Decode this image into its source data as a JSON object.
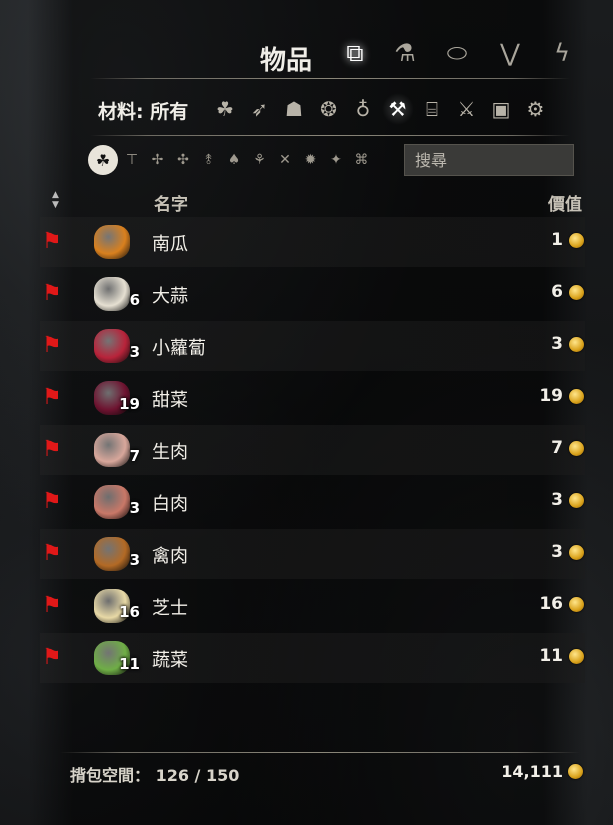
{
  "inventory": {
    "title": "物品",
    "categories": [
      {
        "name": "items",
        "icon": "cube-stack-icon",
        "glyph": "⧉",
        "active": true
      },
      {
        "name": "alchemy",
        "icon": "flask-icon",
        "glyph": "⚗",
        "active": false
      },
      {
        "name": "armor",
        "icon": "shield-icon",
        "glyph": "⬭",
        "active": false
      },
      {
        "name": "weapons",
        "icon": "blades-icon",
        "glyph": "⋁",
        "active": false
      },
      {
        "name": "misc",
        "icon": "lightning-icon",
        "glyph": "ϟ",
        "active": false
      }
    ],
    "filter": {
      "label": "材料: 所有",
      "icons": [
        {
          "icon": "triquetra-icon",
          "glyph": "☘",
          "active": false
        },
        {
          "icon": "bow-icon",
          "glyph": "➶",
          "active": false
        },
        {
          "icon": "hood-icon",
          "glyph": "☗",
          "active": false
        },
        {
          "icon": "rope-icon",
          "glyph": "❂",
          "active": false
        },
        {
          "icon": "potion-icon",
          "glyph": "♁",
          "active": false
        },
        {
          "icon": "crafting-hammer-icon",
          "glyph": "⚒",
          "active": true
        },
        {
          "icon": "scroll-icon",
          "glyph": "⌸",
          "active": false
        },
        {
          "icon": "sword-bone-icon",
          "glyph": "⚔",
          "active": false
        },
        {
          "icon": "blocks-icon",
          "glyph": "▣",
          "active": false
        },
        {
          "icon": "gears-icon",
          "glyph": "⚙",
          "active": false
        }
      ]
    },
    "subfilters": [
      {
        "icon": "all-materials-icon",
        "glyph": "☘",
        "active": true
      },
      {
        "icon": "anvil-icon",
        "glyph": "⊤",
        "active": false
      },
      {
        "icon": "herb-icon",
        "glyph": "✢",
        "active": false
      },
      {
        "icon": "plant-icon",
        "glyph": "✣",
        "active": false
      },
      {
        "icon": "torch-icon",
        "glyph": "⥉",
        "active": false
      },
      {
        "icon": "mushroom-icon",
        "glyph": "♠",
        "active": false
      },
      {
        "icon": "flower-icon",
        "glyph": "⚘",
        "active": false
      },
      {
        "icon": "crossed-tools-icon",
        "glyph": "✕",
        "active": false
      },
      {
        "icon": "gem-icon",
        "glyph": "✹",
        "active": false
      },
      {
        "icon": "sparkle-icon",
        "glyph": "✦",
        "active": false
      },
      {
        "icon": "junk-icon",
        "glyph": "⌘",
        "active": false
      }
    ],
    "search_placeholder": "搜尋",
    "columns": {
      "name": "名字",
      "value": "價值"
    },
    "sort_icon": "▲▼",
    "items": [
      {
        "name": "南瓜",
        "qty": "",
        "value": "1",
        "icon": "pumpkin-icon",
        "color": "#d9801e"
      },
      {
        "name": "大蒜",
        "qty": "6",
        "value": "6",
        "icon": "garlic-icon",
        "color": "#e6e0d2"
      },
      {
        "name": "小蘿蔔",
        "qty": "3",
        "value": "3",
        "icon": "radish-icon",
        "color": "#b8233a"
      },
      {
        "name": "甜菜",
        "qty": "19",
        "value": "19",
        "icon": "beet-icon",
        "color": "#6e1330"
      },
      {
        "name": "生肉",
        "qty": "7",
        "value": "7",
        "icon": "raw-meat-icon",
        "color": "#d8a79b"
      },
      {
        "name": "白肉",
        "qty": "3",
        "value": "3",
        "icon": "white-meat-icon",
        "color": "#c97868"
      },
      {
        "name": "禽肉",
        "qty": "3",
        "value": "3",
        "icon": "poultry-icon",
        "color": "#b36a25"
      },
      {
        "name": "芝士",
        "qty": "16",
        "value": "16",
        "icon": "cheese-icon",
        "color": "#e8d9a6"
      },
      {
        "name": "蔬菜",
        "qty": "11",
        "value": "11",
        "icon": "vegetables-icon",
        "color": "#6fae46"
      }
    ],
    "footer": {
      "capacity_label": "揹包空間： 126 / 150",
      "gold_total": "14,111"
    },
    "tag_icon": "red-tag-icon",
    "tag_glyph": "⚑",
    "tag_color": "#e01818",
    "coin_icon": "gold-coin-icon"
  }
}
